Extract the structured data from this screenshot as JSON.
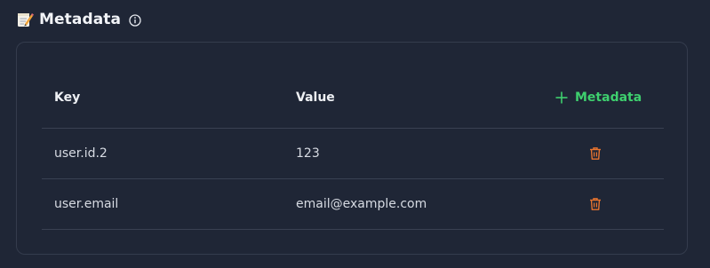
{
  "section": {
    "title": "Metadata",
    "icon": "memo-icon",
    "info_icon": "info-icon"
  },
  "table": {
    "columns": {
      "key": "Key",
      "value": "Value"
    },
    "add_button_label": "Metadata",
    "rows": [
      {
        "key": "user.id.2",
        "value": "123"
      },
      {
        "key": "user.email",
        "value": "email@example.com"
      }
    ]
  },
  "colors": {
    "background": "#1f2636",
    "accent_green": "#3ecf6e",
    "delete_orange": "#e8742f"
  }
}
